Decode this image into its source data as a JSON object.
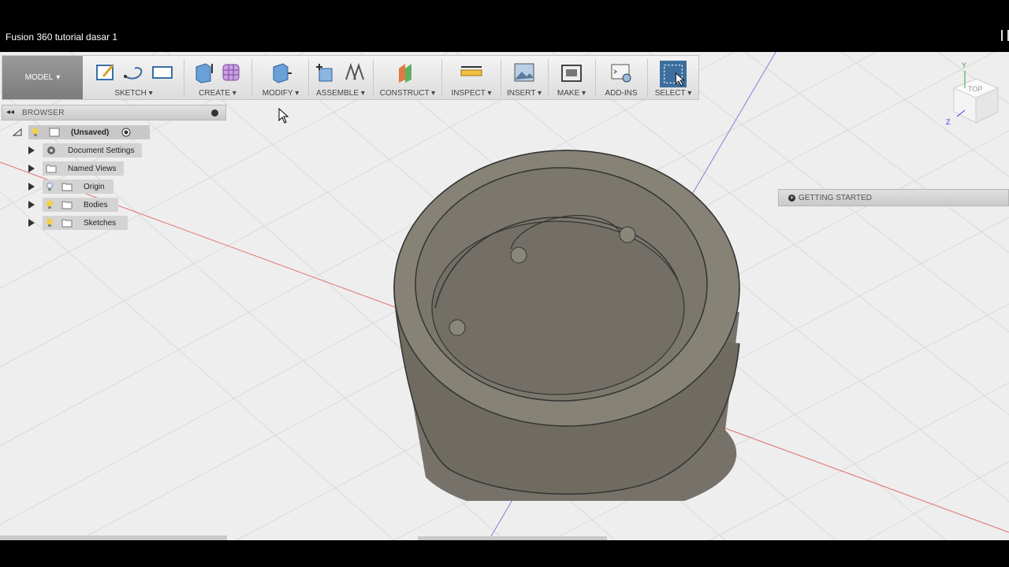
{
  "window": {
    "title": "Fusion 360 tutorial dasar 1"
  },
  "toolbar": {
    "model_label": "MODEL",
    "groups": {
      "sketch": "SKETCH",
      "create": "CREATE",
      "modify": "MODIFY",
      "assemble": "ASSEMBLE",
      "construct": "CONSTRUCT",
      "inspect": "INSPECT",
      "insert": "INSERT",
      "make": "MAKE",
      "addins": "ADD-INS",
      "select": "SELECT"
    },
    "dropdown_glyph": "▾"
  },
  "browser": {
    "title": "BROWSER",
    "root": "(Unsaved)",
    "items": {
      "document_settings": "Document Settings",
      "named_views": "Named Views",
      "origin": "Origin",
      "bodies": "Bodies",
      "sketches": "Sketches"
    }
  },
  "getting_started": {
    "label": "GETTING STARTED"
  },
  "viewcube": {
    "face": "TOP",
    "axis_y": "Y",
    "axis_z": "Z"
  },
  "colors": {
    "viewport_bg": "#eeeeee",
    "grid": "#d8d8d8",
    "axis_red": "#e06060",
    "axis_blue": "#7a7ae0",
    "model_body": "#7a766c",
    "model_dark": "#6b675d",
    "select_blue": "#3d6f9e"
  }
}
